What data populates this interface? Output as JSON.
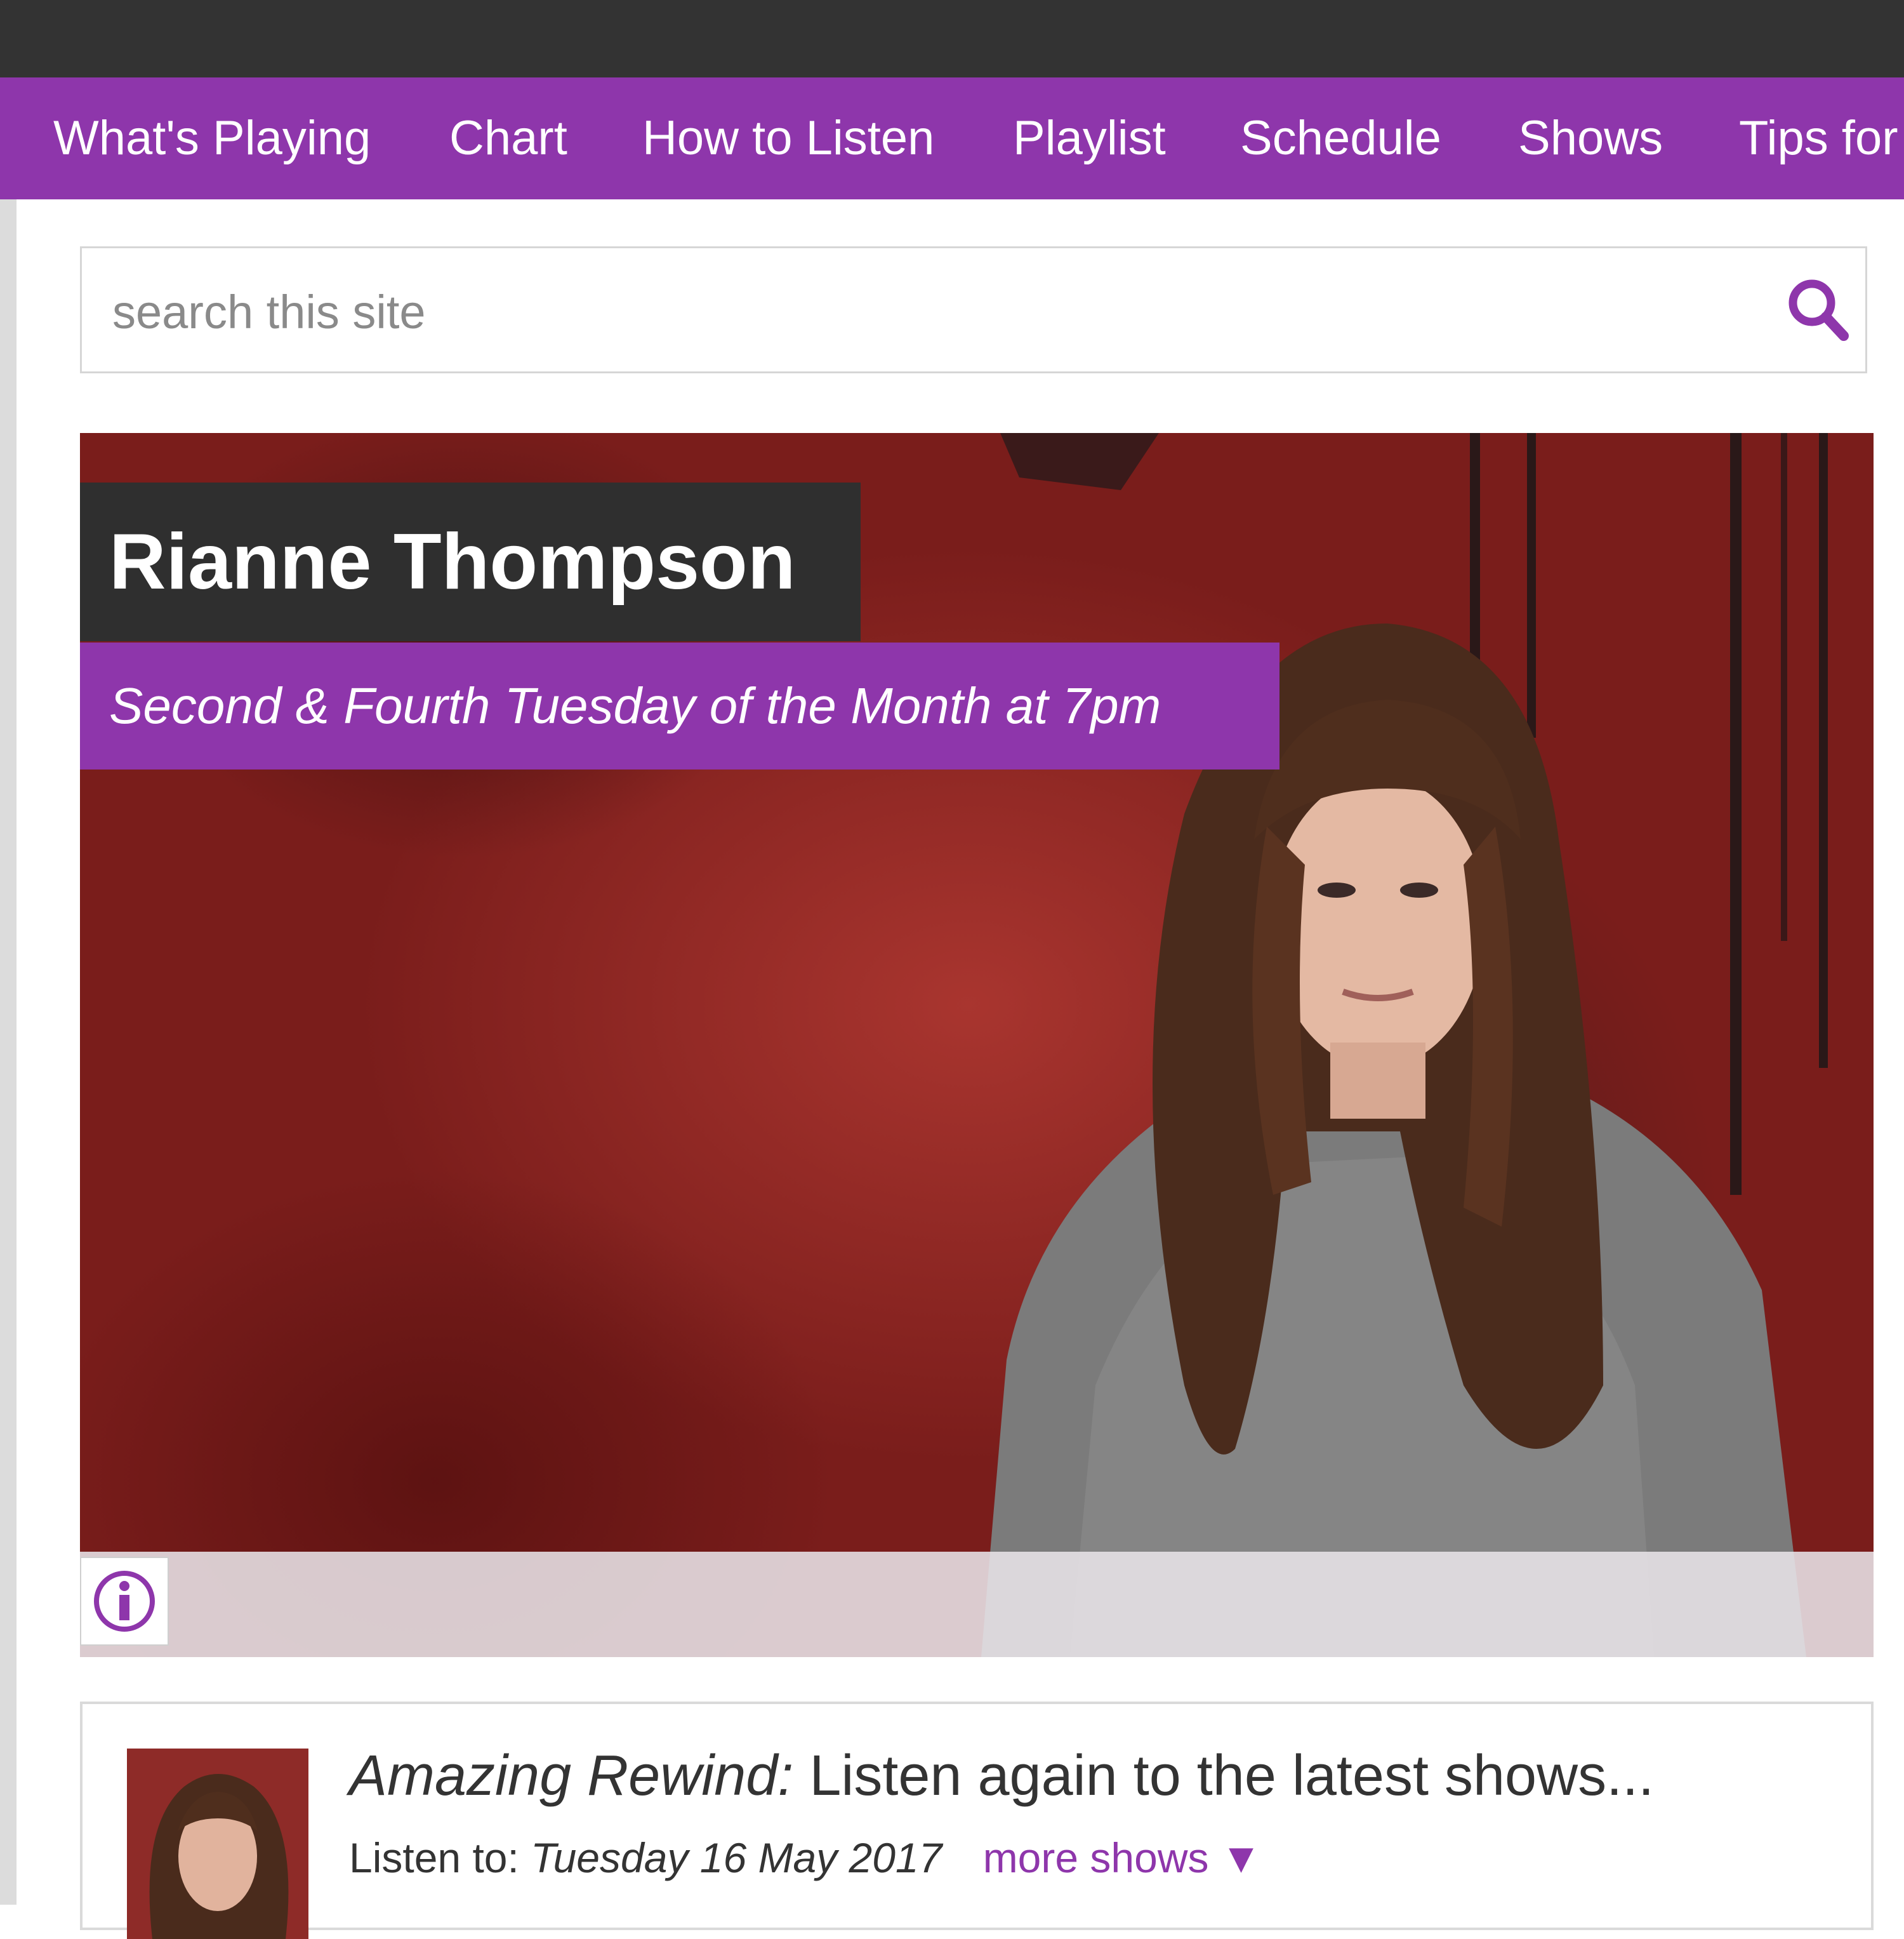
{
  "nav": {
    "items": [
      "What's Playing",
      "Chart",
      "How to Listen",
      "Playlist",
      "Schedule",
      "Shows",
      "Tips for"
    ]
  },
  "search": {
    "placeholder": "search this site",
    "icon": "search-icon"
  },
  "hero": {
    "title": "Rianne Thompson",
    "subtitle": "Second & Fourth Tuesday of the Month at 7pm",
    "info_icon": "info-icon"
  },
  "rewind": {
    "title_em": "Amazing Rewind:",
    "title_rest": " Listen again to the latest shows...",
    "listen_label": "Listen to: ",
    "date": "Tuesday 16 May 2017",
    "more_shows": "more shows",
    "more_icon": "caret-down-icon"
  },
  "colors": {
    "accent": "#8e36ab",
    "topbar": "#333333",
    "title_bg": "#2f2f2f"
  }
}
